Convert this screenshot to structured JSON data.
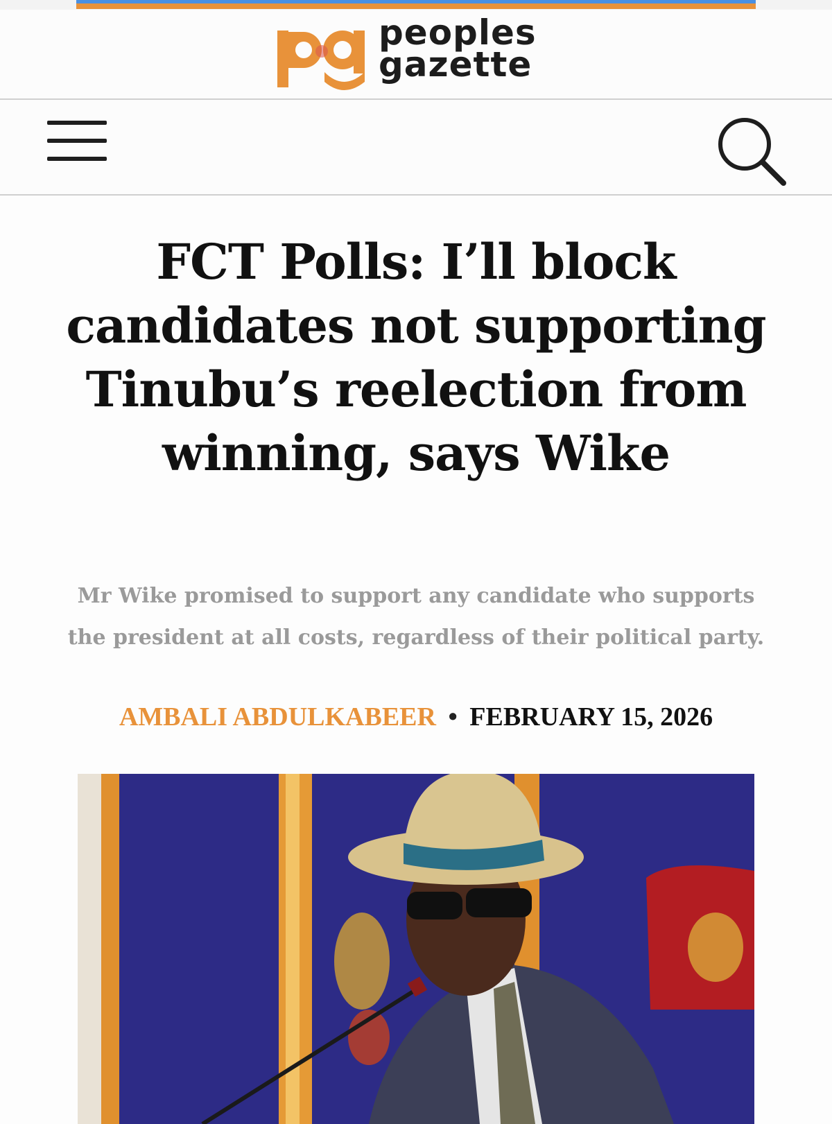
{
  "site": {
    "name_line1": "peoples",
    "name_line2": "gazette",
    "brand_color": "#e8923a"
  },
  "nav": {
    "menu_icon": "hamburger-menu-icon",
    "search_icon": "search-icon"
  },
  "article": {
    "headline": "FCT Polls: I’ll block candidates not supporting Tinubu’s reelection from winning, says Wike",
    "summary": "Mr Wike promised to support any candidate who supports the president at all costs, regardless of their political party.",
    "author": "AMBALI ABDULKABEER",
    "separator": "•",
    "date": "FEBRUARY 15, 2026"
  },
  "colors": {
    "author": "#e8923a",
    "summary": "#9a9a9a",
    "headline": "#111111"
  }
}
